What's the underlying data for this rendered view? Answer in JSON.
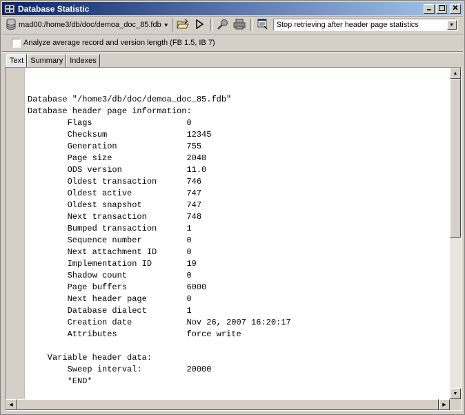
{
  "window": {
    "title": "Database Statistic",
    "minimize_icon": "minimize-icon",
    "maximize_icon": "maximize-icon",
    "close_icon": "close-icon"
  },
  "toolbar": {
    "database": "mad00:/home3/db/doc/demoa_doc_85.fdb",
    "retrieve_option": "Stop retrieving after header page statistics",
    "icons": [
      "database-icon",
      "open-file-icon",
      "run-icon",
      "find-icon",
      "print-icon",
      "options-icon"
    ]
  },
  "options": {
    "analyze_label": "Analyze average record and version length (FB 1.5, IB 7)",
    "analyze_checked": false
  },
  "tabs": [
    {
      "label": "Text",
      "active": true
    },
    {
      "label": "Summary",
      "active": false
    },
    {
      "label": "Indexes",
      "active": false
    }
  ],
  "output": {
    "lines": [
      "Database \"/home3/db/doc/demoa_doc_85.fdb\"",
      "Database header page information:",
      "        Flags                   0",
      "        Checksum                12345",
      "        Generation              755",
      "        Page size               2048",
      "        ODS version             11.0",
      "        Oldest transaction      746",
      "        Oldest active           747",
      "        Oldest snapshot         747",
      "        Next transaction        748",
      "        Bumped transaction      1",
      "        Sequence number         0",
      "        Next attachment ID      0",
      "        Implementation ID       19",
      "        Shadow count            0",
      "        Page buffers            6000",
      "        Next header page        0",
      "        Database dialect        1",
      "        Creation date           Nov 26, 2007 16:20:17",
      "        Attributes              force write",
      "",
      "    Variable header data:",
      "        Sweep interval:         20000",
      "        *END*"
    ]
  }
}
